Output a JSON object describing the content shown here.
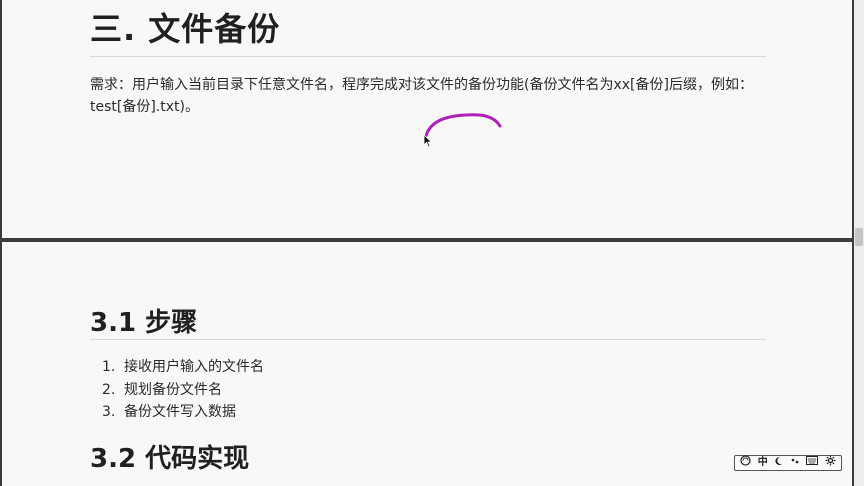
{
  "section": {
    "title": "三. 文件备份",
    "requirement": "需求：用户输入当前目录下任意文件名，程序完成对该文件的备份功能(备份文件名为xx[备份]后缀，例如：test[备份].txt)。"
  },
  "subsection_steps": {
    "title": "3.1 步骤",
    "items": [
      {
        "num": "1.",
        "text": "接收用户输入的文件名"
      },
      {
        "num": "2.",
        "text": "规划备份文件名"
      },
      {
        "num": "3.",
        "text": "备份文件写入数据"
      }
    ]
  },
  "subsection_code": {
    "title": "3.2 代码实现"
  },
  "ime_toolbar": {
    "lang_label": "中",
    "icons": [
      "ime-logo-icon",
      "moon-icon",
      "punctuation-icon",
      "keyboard-icon",
      "gear-icon"
    ]
  },
  "annotation_color": "#b01fb8"
}
